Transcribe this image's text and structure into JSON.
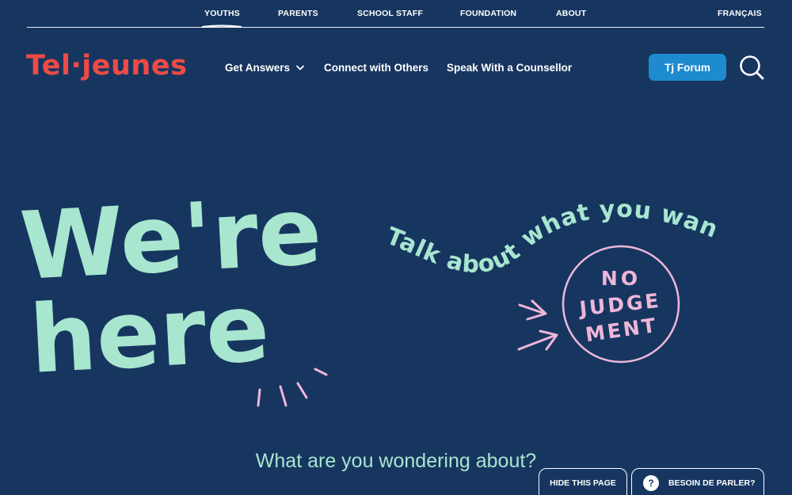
{
  "top_nav": {
    "youths": "YOUTHS",
    "parents": "PARENTS",
    "school_staff": "SCHOOL STAFF",
    "foundation": "FOUNDATION",
    "about": "ABOUT",
    "language": "FRANÇAIS"
  },
  "header": {
    "logo": "Tel·jeunes",
    "nav_get_answers": "Get Answers",
    "nav_connect": "Connect with Others",
    "nav_speak": "Speak With a Counsellor",
    "forum_button": "Tj Forum"
  },
  "hero": {
    "line1": "We're",
    "line2": "here",
    "curved_text": "Talk about what you want",
    "badge_line1": "NO",
    "badge_line2": "JUDGE",
    "badge_line3": "MENT"
  },
  "question": "What are you wondering about?",
  "bottom": {
    "hide_button": "HIDE THIS PAGE",
    "help_icon": "?",
    "talk_button": "BESOIN DE PARLER?"
  },
  "colors": {
    "background": "#163660",
    "accent_mint": "#a8e6cf",
    "accent_pink": "#efb6d8",
    "logo_red": "#ef4a45",
    "forum_blue": "#1f8bcf"
  }
}
